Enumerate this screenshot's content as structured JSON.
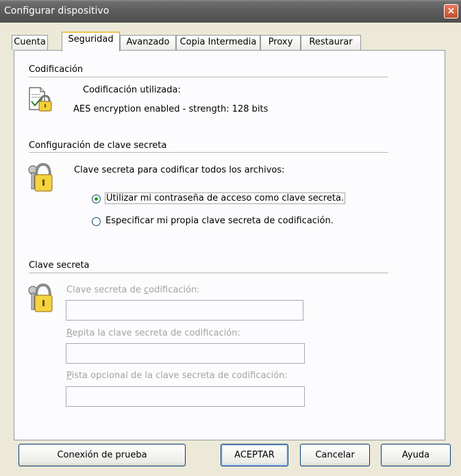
{
  "window": {
    "title": "Configurar dispositivo",
    "close_label": "×"
  },
  "tabs": [
    {
      "label": "Cuenta"
    },
    {
      "label": "Seguridad",
      "active": true
    },
    {
      "label": "Avanzado"
    },
    {
      "label": "Copia Intermedia"
    },
    {
      "label": "Proxy"
    },
    {
      "label": "Restaurar"
    }
  ],
  "encryption": {
    "section_title": "Codificación",
    "label": "Codificación utilizada:",
    "value": "AES encryption enabled - strength: 128 bits",
    "icon": "document-lock-icon"
  },
  "key_config": {
    "section_title": "Configuración de clave secreta",
    "prompt": "Clave secreta para codificar todos los archivos:",
    "icon": "padlock-keys-icon",
    "options": [
      {
        "label": "Utilizar mi contraseña de acceso como clave secreta.",
        "checked": true
      },
      {
        "label": "Especificar mi propia clave secreta de codificación.",
        "checked": false
      }
    ]
  },
  "secret_key": {
    "section_title": "Clave secreta",
    "icon": "padlock-keys-icon",
    "key_label_pre": "Clave secreta de ",
    "key_label_accel": "c",
    "key_label_post": "odificación:",
    "key_value": "",
    "repeat_label_accel": "R",
    "repeat_label_post": "epita la clave secreta de codificación:",
    "repeat_value": "",
    "hint_label_accel": "P",
    "hint_label_post": "ista opcional de la clave secreta de codificación:",
    "hint_value": ""
  },
  "buttons": {
    "test_connection": "Conexión de prueba",
    "ok": "ACEPTAR",
    "cancel": "Cancelar",
    "help": "Ayuda"
  },
  "colors": {
    "titlebar": "#5c5c5c",
    "dialog_bg": "#ece9d8",
    "panel_bg": "#fcfcfe",
    "radio_dot": "#21a121",
    "disabled_text": "#a3a3a3"
  }
}
